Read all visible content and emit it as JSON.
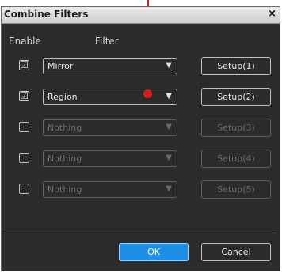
{
  "window": {
    "title": "Combine Filters",
    "close_glyph": "×"
  },
  "headers": {
    "enable": "Enable",
    "filter": "Filter"
  },
  "rows": [
    {
      "checked": true,
      "check_glyph": "☑",
      "filter": "Mirror",
      "arrow": "▼",
      "setup": "Setup(1)",
      "enabled": true
    },
    {
      "checked": true,
      "check_glyph": "☑",
      "filter": "Region",
      "arrow": "▼",
      "setup": "Setup(2)",
      "enabled": true
    },
    {
      "checked": false,
      "check_glyph": "",
      "filter": "Nothing",
      "arrow": "▼",
      "setup": "Setup(3)",
      "enabled": false
    },
    {
      "checked": false,
      "check_glyph": "",
      "filter": "Nothing",
      "arrow": "▼",
      "setup": "Setup(4)",
      "enabled": false
    },
    {
      "checked": false,
      "check_glyph": "",
      "filter": "Nothing",
      "arrow": "▼",
      "setup": "Setup(5)",
      "enabled": false
    }
  ],
  "footer": {
    "ok": "OK",
    "cancel": "Cancel"
  },
  "colors": {
    "accent": "#1e8fe6",
    "pointer": "#d81b1b",
    "background": "#2b2b2b"
  }
}
